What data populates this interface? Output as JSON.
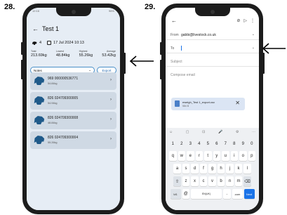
{
  "steps": {
    "left": "28.",
    "right": "29."
  },
  "phone1": {
    "status_time": "12:16",
    "status_right": "96%",
    "back_icon": "←",
    "title": "Test 1",
    "count": "4",
    "datetime": "17 Jul 2024 10:13",
    "stats": [
      {
        "label": "Total",
        "value": "213.69kg"
      },
      {
        "label": "Lowest",
        "value": "48.84kg"
      },
      {
        "label": "Highest",
        "value": "55.26kg"
      },
      {
        "label": "Average",
        "value": "53.42kg"
      }
    ],
    "notes_label": "Notes",
    "notes_icon": "chevron-down-icon",
    "export_label": "Export",
    "animals": [
      {
        "tag": "969 000000536771",
        "weight": "54.84kg"
      },
      {
        "tag": "826 024709300005",
        "weight": "54.94kg"
      },
      {
        "tag": "826 024709300008",
        "weight": "48.84kg"
      },
      {
        "tag": "826 024709300004",
        "weight": "55.26kg"
      }
    ],
    "chevron": "›"
  },
  "phone2": {
    "back_icon": "←",
    "from_label": "From",
    "from_value": "gabbi@livestock.co.uk",
    "to_label": "To",
    "subject_placeholder": "Subject",
    "compose_placeholder": "Compose email",
    "attachment_name": "eweigh_Test 1_export.csv",
    "attachment_size": "584 B",
    "attachment_close": "✕",
    "kb_tools": [
      "☺",
      "▢",
      "⊡",
      "🎤",
      "⚙",
      "⋯"
    ],
    "kb_numbers": [
      "1",
      "2",
      "3",
      "4",
      "5",
      "6",
      "7",
      "8",
      "9",
      "0"
    ],
    "kb_row1": [
      "q",
      "w",
      "e",
      "r",
      "t",
      "y",
      "u",
      "i",
      "o",
      "p"
    ],
    "kb_row2": [
      "a",
      "s",
      "d",
      "f",
      "g",
      "h",
      "j",
      "k",
      "l"
    ],
    "kb_row3": [
      "⇧",
      "z",
      "x",
      "c",
      "v",
      "b",
      "n",
      "m",
      "⌫"
    ],
    "kb_sym": "!#1",
    "kb_at": "@",
    "kb_space": "EN(UK)",
    "kb_dot": ".",
    "kb_com": ".com",
    "kb_next": "Next"
  },
  "colors": {
    "accent": "#4a90c8",
    "card": "#cfd9e4",
    "app_bg": "#e6edf5",
    "keyboard_blue": "#1a73e8"
  }
}
